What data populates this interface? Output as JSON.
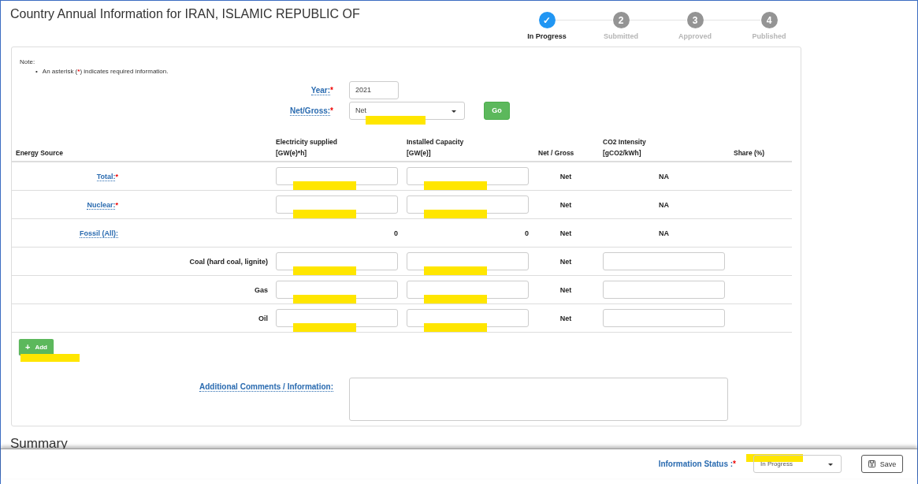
{
  "title": "Country Annual Information for IRAN, ISLAMIC REPUBLIC OF",
  "steps": [
    {
      "marker": "✓",
      "label": "In Progress",
      "selected": true
    },
    {
      "marker": "2",
      "label": "Submitted",
      "selected": false
    },
    {
      "marker": "3",
      "label": "Approved",
      "selected": false
    },
    {
      "marker": "4",
      "label": "Published",
      "selected": false
    }
  ],
  "note": {
    "heading": "Note:",
    "bullet": "•",
    "before": "An asterisk (",
    "mark": "*",
    "after": ") indicates required information."
  },
  "filters": [
    {
      "label": "Year:",
      "required": true,
      "kind": "text",
      "value": "2021",
      "highlighted": false
    },
    {
      "label": "Net/Gross:",
      "required": true,
      "kind": "select",
      "value": "Net",
      "highlighted": true
    }
  ],
  "go_button": "Go",
  "columns": [
    {
      "lines": [
        "Energy Source"
      ]
    },
    {
      "lines": [
        "Electricity supplied",
        "[GW(e)*h]"
      ]
    },
    {
      "lines": [
        "Installed Capacity",
        "[GW(e)]"
      ]
    },
    {
      "lines": [
        "Net / Gross"
      ]
    },
    {
      "lines": [
        "CO2 Intensity",
        "[gCO2/kWh]"
      ]
    },
    {
      "lines": [
        "Share (%)"
      ]
    }
  ],
  "rows": [
    {
      "source": "Total:",
      "kind": "main",
      "required": true,
      "electricity": {
        "kind": "input",
        "highlighted": true
      },
      "capacity": {
        "kind": "input",
        "highlighted": true
      },
      "net_gross": "Net",
      "co2": {
        "kind": "text",
        "value": "NA"
      }
    },
    {
      "source": "Nuclear:",
      "kind": "main",
      "required": true,
      "electricity": {
        "kind": "input",
        "highlighted": true
      },
      "capacity": {
        "kind": "input",
        "highlighted": true
      },
      "net_gross": "Net",
      "co2": {
        "kind": "text",
        "value": "NA"
      }
    },
    {
      "source": "Fossil (All):",
      "kind": "main",
      "required": false,
      "electricity": {
        "kind": "text",
        "value": "0"
      },
      "capacity": {
        "kind": "text",
        "value": "0"
      },
      "net_gross": "Net",
      "co2": {
        "kind": "text",
        "value": "NA"
      }
    },
    {
      "source": "Coal (hard coal, lignite)",
      "kind": "sub",
      "required": false,
      "electricity": {
        "kind": "input",
        "highlighted": true
      },
      "capacity": {
        "kind": "input",
        "highlighted": true
      },
      "net_gross": "Net",
      "co2": {
        "kind": "input",
        "highlighted": false
      }
    },
    {
      "source": "Gas",
      "kind": "sub",
      "required": false,
      "electricity": {
        "kind": "input",
        "highlighted": true
      },
      "capacity": {
        "kind": "input",
        "highlighted": true
      },
      "net_gross": "Net",
      "co2": {
        "kind": "input",
        "highlighted": false
      }
    },
    {
      "source": "Oil",
      "kind": "sub",
      "required": false,
      "electricity": {
        "kind": "input",
        "highlighted": true
      },
      "capacity": {
        "kind": "input",
        "highlighted": true
      },
      "net_gross": "Net",
      "co2": {
        "kind": "input",
        "highlighted": false
      }
    }
  ],
  "add_button": {
    "icon": "+",
    "label": "Add",
    "highlighted": true
  },
  "comments": {
    "label": "Additional Comments / Information:"
  },
  "summary": "Summary",
  "footer": {
    "label": "Information Status :",
    "required": true,
    "value": "In Progress",
    "highlighted": true,
    "save": "Save"
  }
}
